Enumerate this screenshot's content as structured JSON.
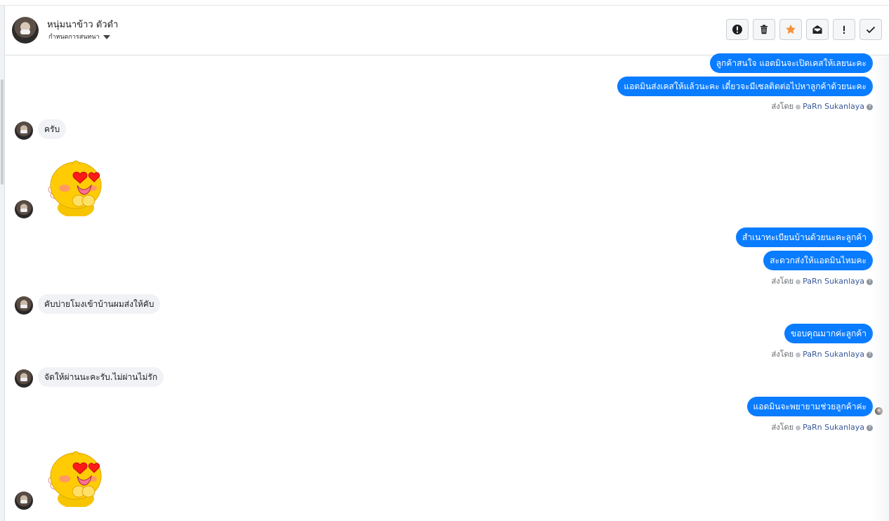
{
  "header": {
    "contact_name": "หนุ่มนาข้าว ตัวดำ",
    "assign_label": "กำหนดการสนทนา"
  },
  "toolbar": {
    "buttons": [
      {
        "name": "alert-button",
        "icon": "exclamation-circle-icon"
      },
      {
        "name": "delete-button",
        "icon": "trash-icon"
      },
      {
        "name": "star-button",
        "icon": "star-icon",
        "color": "#f7923a"
      },
      {
        "name": "mark-unread-button",
        "icon": "envelope-open-icon"
      },
      {
        "name": "follow-up-button",
        "icon": "exclamation-icon"
      },
      {
        "name": "done-button",
        "icon": "check-icon"
      }
    ]
  },
  "colors": {
    "outgoing_bubble": "#0a7cff",
    "incoming_bubble": "#f0f2f5",
    "sender_link": "#385898"
  },
  "messages": [
    {
      "dir": "out",
      "text": "ลูกค้าสนใจ แอดมินจะเปิดเคสให้เลยนะคะ"
    },
    {
      "dir": "out",
      "text": "แอดมินส่งเคสให้แล้วนะคะ เดี๋ยวจะมีเซลติดต่อไปหาลูกค้าด้วยนะคะ"
    },
    {
      "dir": "in",
      "text": "ครับ"
    },
    {
      "dir": "out",
      "text": "สำเนาทะเบียนบ้านด้วยนะคะลูกค้า"
    },
    {
      "dir": "out",
      "text": "สะดวกส่งให้แอดมินไหมคะ"
    },
    {
      "dir": "in",
      "text": "คับบ่ายโมงเข้าบ้านผมส่งให้คับ"
    },
    {
      "dir": "out",
      "text": "ขอบคุณมากค่ะลูกค้า"
    },
    {
      "dir": "in",
      "text": "จัดให้ผ่านนะคะรับ.ไม่ผ่านไม่รัก"
    },
    {
      "dir": "out",
      "text": "แอดมินจะพยายามช่วยลูกค้าค่ะ"
    }
  ],
  "sent_by": {
    "prefix": "ส่งโดย",
    "name": "PaRn Sukanlaya"
  }
}
